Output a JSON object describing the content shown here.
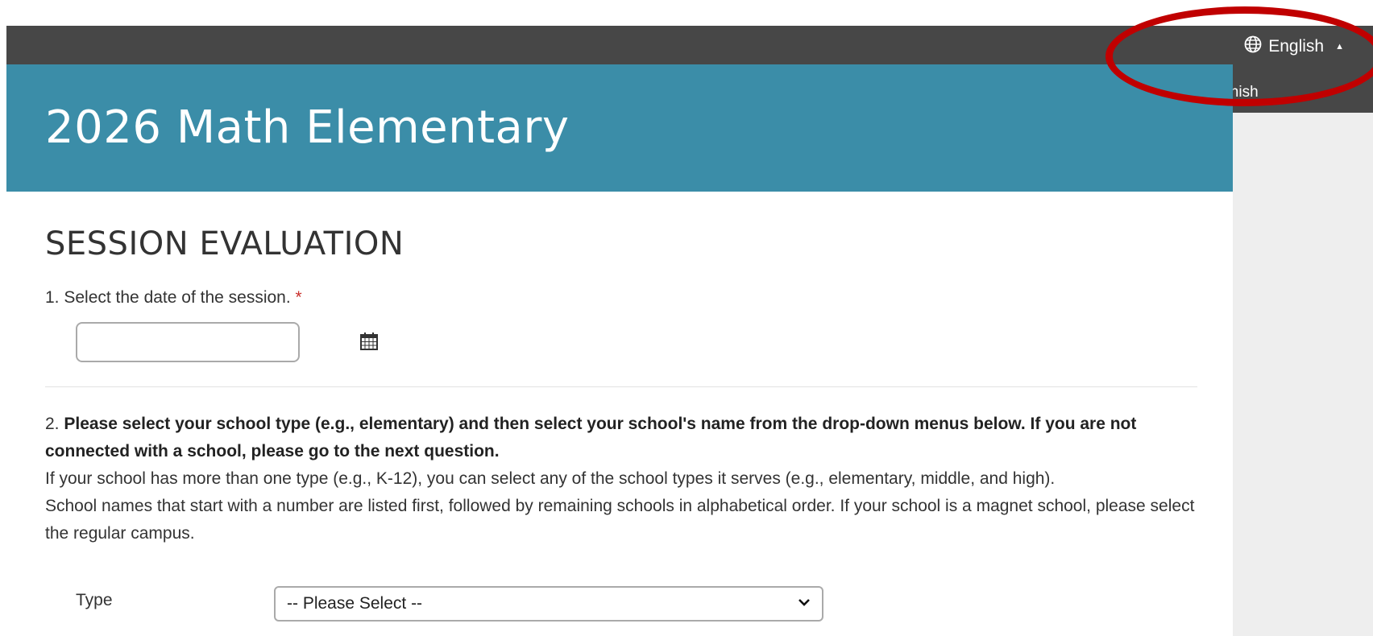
{
  "top_bar": {
    "language_current": "English",
    "language_options": [
      "Spanish"
    ]
  },
  "header": {
    "title": "2026 Math Elementary"
  },
  "section": {
    "heading": "SESSION EVALUATION"
  },
  "question1": {
    "label": "1. Select the date of the session.",
    "required_mark": "*",
    "date_value": "",
    "icon": "calendar-icon"
  },
  "question2": {
    "number": "2.",
    "bold_text": "Please select your school type (e.g., elementary) and then select your school's name from the drop-down menus below. If you are not connected with a school, please go to the next question.",
    "note1": "If your school has more than one type (e.g., K-12), you can select any of the school types it serves (e.g., elementary, middle, and high).",
    "note2": "School names that start with a number are listed first, followed by remaining schools in alphabetical order. If your school is a magnet school, please select the regular campus.",
    "type_label": "Type",
    "type_select_value": "-- Please Select --"
  },
  "colors": {
    "header_bg": "#3b8da8",
    "top_bar_bg": "#474747",
    "highlight": "#c00000",
    "required": "#c9302c"
  }
}
